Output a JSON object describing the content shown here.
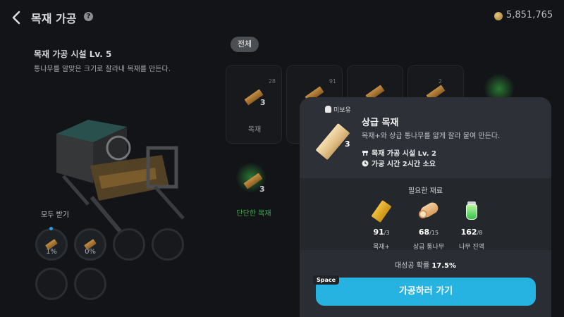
{
  "header": {
    "title": "목재 가공",
    "help_glyph": "?",
    "currency_amount": "5,851,765"
  },
  "facility": {
    "name": "목재 가공 시설 Lv. 5",
    "description": "통나무를 알맞은 크기로 잘라내 목재를 만든다."
  },
  "collection": {
    "collect_all_label": "모두 받기",
    "slots": [
      {
        "percent_label": "1%"
      },
      {
        "percent_label": "0%"
      }
    ]
  },
  "filter": {
    "all_tab_label": "전체"
  },
  "recipe_cards": [
    {
      "name": "목재",
      "owned": "28",
      "qty": "3"
    },
    {
      "owned": "91"
    },
    {},
    {
      "owned": "2"
    }
  ],
  "green_card": {
    "name": "단단한 목재",
    "qty": "3"
  },
  "detail": {
    "unowned_label": "미보유",
    "item_name": "상급 목재",
    "item_qty": "3",
    "description": "목재+와 상급 통나무를 얇게 잘라 붙여 만든다.",
    "facility_req": "목재 가공 시설 Lv. 2",
    "time_req": "가공 시간 2시간 소요",
    "materials_title": "필요한 재료",
    "materials": [
      {
        "name": "목재+",
        "have": "91",
        "need": "/3"
      },
      {
        "name": "상급 통나무",
        "have": "68",
        "need": "/15"
      },
      {
        "name": "나무 진액",
        "have": "162",
        "need": "/8"
      }
    ],
    "success_label": "대성공 확률",
    "success_rate": "17.5%",
    "hotkey_label": "Space",
    "go_button_label": "가공하러 가기"
  },
  "colors": {
    "accent_button": "#26b3e2",
    "panel_bg": "#2a2d33",
    "page_bg": "#121417",
    "green_highlight": "#3fae4e"
  }
}
